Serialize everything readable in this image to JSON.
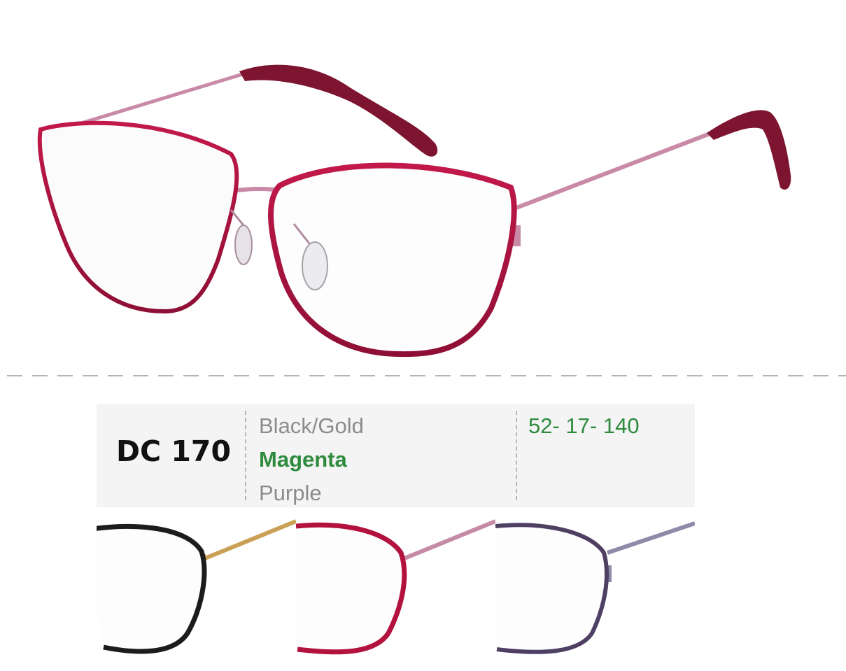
{
  "product": {
    "model": "DC 170",
    "size": "52- 17- 140",
    "colors": [
      {
        "label": "Black/Gold",
        "selected": false
      },
      {
        "label": "Magenta",
        "selected": true
      },
      {
        "label": "Purple",
        "selected": false
      }
    ]
  },
  "palette": {
    "accent_green": "#2e8b3e",
    "magenta_rim": "#b3123f",
    "magenta_temple": "#c48aa6",
    "black_rim": "#1c1c1c",
    "gold_temple": "#c9a055",
    "purple_rim": "#4e3f63",
    "purple_temple": "#8f8aa8"
  },
  "images": {
    "hero": "magenta-cat-eye-glasses",
    "thumbnails": [
      "black-gold-glasses",
      "magenta-glasses",
      "purple-glasses"
    ]
  }
}
